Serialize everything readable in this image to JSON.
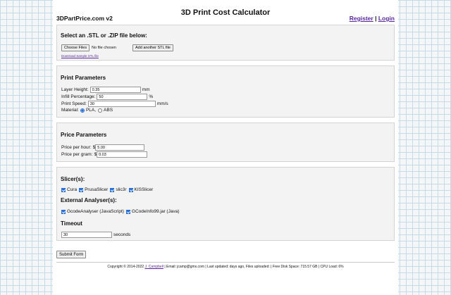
{
  "header": {
    "site_name": "3DPartPrice.com v2",
    "title": "3D Print Cost Calculator",
    "register": "Register",
    "separator": "|",
    "login": "Login"
  },
  "upload": {
    "heading": "Select an .STL or .ZIP file below:",
    "choose_files": "Choose Files",
    "no_file": "No file chosen",
    "add_another": "Add another STL file",
    "sample_link": "Download Sample STL file"
  },
  "print_params": {
    "heading": "Print Parameters",
    "layer_height": {
      "label": "Layer Height:",
      "value": "0.35",
      "unit": "mm"
    },
    "infill": {
      "label": "Infill Percentage:",
      "value": "50",
      "unit": "%"
    },
    "speed": {
      "label": "Print Speed:",
      "value": "30",
      "unit": "mm/s"
    },
    "material": {
      "label": "Material:",
      "options": [
        "PLA,",
        "ABS"
      ],
      "selected": "PLA"
    }
  },
  "price_params": {
    "heading": "Price Parameters",
    "per_hour": {
      "label": "Price per hour:",
      "currency": "$",
      "value": "5.00"
    },
    "per_gram": {
      "label": "Price per gram:",
      "currency": "$",
      "value": "0.03"
    }
  },
  "slicers": {
    "heading": "Slicer(s):",
    "items": [
      "Cura",
      "PrusaSlicer",
      "slic3r",
      "KISSlicer"
    ]
  },
  "analysers": {
    "heading": "External Analyser(s):",
    "items": [
      "GcodeAnalyser (JavaScript)",
      "GCodeInfo99.jar (Java)"
    ]
  },
  "timeout": {
    "heading": "Timeout",
    "value": "30",
    "unit": "seconds"
  },
  "submit": "Submit Form",
  "footer": {
    "prefix": "Copyright © 2014-2022",
    "author": "J. Campbell",
    "rest": "| Email: jcamp@gmx.com | Last updated: days ago, Files uploaded: | Free Disk Space: 715.57 GB | CPU Load: 6%"
  },
  "colors": {
    "link": "#5a2a9a",
    "check": "#2a6fd6",
    "grid": "#c5dbe8"
  }
}
